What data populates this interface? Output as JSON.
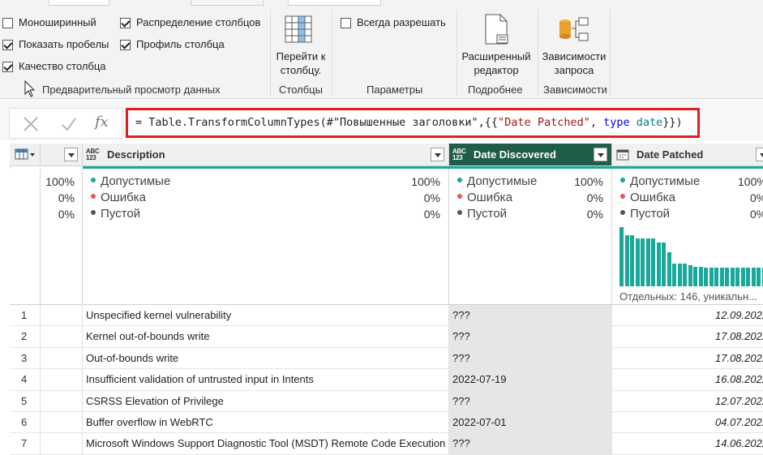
{
  "ribbon": {
    "checkboxes": [
      {
        "label": "Моноширинный",
        "checked": false
      },
      {
        "label": "Показать пробелы",
        "checked": true
      },
      {
        "label": "Качество столбца",
        "checked": true
      },
      {
        "label": "Распределение столбцов",
        "checked": true
      },
      {
        "label": "Профиль столбца",
        "checked": true
      },
      {
        "label": "Всегда разрешать",
        "checked": false
      }
    ],
    "group_preview": "Предварительный просмотр данных",
    "goto_column": "Перейти к столбцу.",
    "group_columns": "Столбцы",
    "group_params": "Параметры",
    "advanced_editor": "Расширенный редактор",
    "group_more": "Подробнее",
    "query_deps": "Зависимости запроса",
    "group_deps": "Зависимости"
  },
  "formula": {
    "text": "= Table.TransformColumnTypes(#\"Повышенные заголовки\",{{\"Date Patched\", type date}})",
    "cancel_icon": "x-icon",
    "confirm_icon": "check-icon",
    "fx_icon": "fx-icon",
    "fx_label": "fx"
  },
  "columns": [
    {
      "name": "Description",
      "type_top": "ABC",
      "type_bottom": "123"
    },
    {
      "name": "Date Discovered",
      "type_top": "ABC",
      "type_bottom": "123"
    },
    {
      "name": "Date Patched",
      "type_icon": "calendar-icon"
    }
  ],
  "profile": {
    "labels": [
      "Допустимые",
      "Ошибка",
      "Пустой"
    ],
    "colors": [
      "#18a99a",
      "#e8575a",
      "#555555"
    ],
    "col0": [
      "100%",
      "0%",
      "0%"
    ],
    "description": [
      "100%",
      "0%",
      "0%"
    ],
    "date_discovered": [
      "100%",
      "0%",
      "0%"
    ],
    "date_patched": [
      "100%",
      "0%",
      "0%"
    ],
    "distinct": "Отдельных: 146, уникальн...",
    "distribution": [
      1.0,
      0.87,
      0.87,
      0.81,
      0.81,
      0.81,
      0.81,
      0.74,
      0.74,
      0.57,
      0.39,
      0.39,
      0.39,
      0.35,
      0.33,
      0.33,
      0.31,
      0.31,
      0.31,
      0.31,
      0.31,
      0.31,
      0.31,
      0.31,
      0.31,
      0.31,
      0.31,
      0.31
    ]
  },
  "rows": [
    {
      "n": "1",
      "description": "Unspecified kernel vulnerability",
      "discovered": "???",
      "patched": "12.09.2022"
    },
    {
      "n": "2",
      "description": "Kernel out-of-bounds write",
      "discovered": "???",
      "patched": "17.08.2022"
    },
    {
      "n": "3",
      "description": "Out-of-bounds write",
      "discovered": "???",
      "patched": "17.08.2022"
    },
    {
      "n": "4",
      "description": "Insufficient validation of untrusted input in Intents",
      "discovered": "2022-07-19",
      "patched": "16.08.2022"
    },
    {
      "n": "5",
      "description": "CSRSS Elevation of Privilege",
      "discovered": "???",
      "patched": "12.07.2022"
    },
    {
      "n": "6",
      "description": "Buffer overflow in WebRTC",
      "discovered": "2022-07-01",
      "patched": "04.07.2022"
    },
    {
      "n": "7",
      "description": "Microsoft Windows Support Diagnostic Tool (MSDT) Remote Code Execution",
      "discovered": "???",
      "patched": "14.06.2022"
    }
  ]
}
